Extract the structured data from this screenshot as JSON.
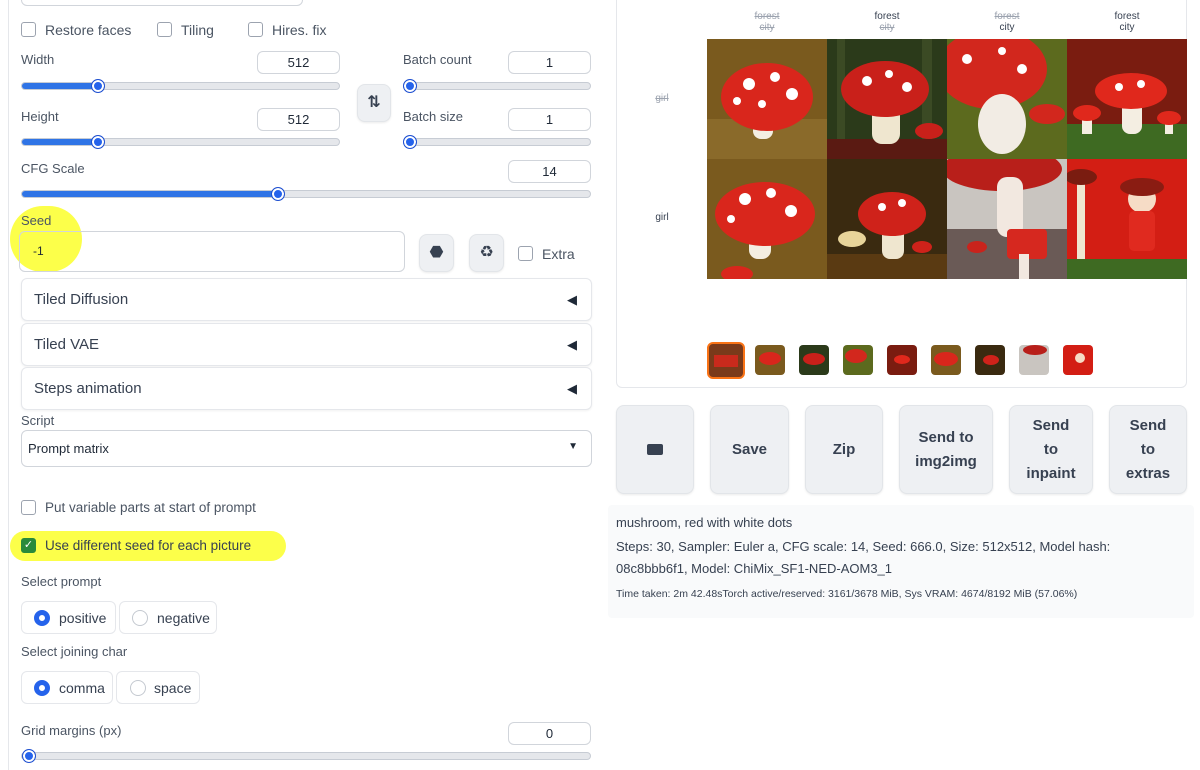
{
  "options": {
    "restore_faces": "Restore faces",
    "tiling": "Tiling",
    "hires_fix": "Hires. fix"
  },
  "width": {
    "label": "Width",
    "value": "512"
  },
  "height": {
    "label": "Height",
    "value": "512"
  },
  "batch_count": {
    "label": "Batch count",
    "value": "1"
  },
  "batch_size": {
    "label": "Batch size",
    "value": "1"
  },
  "cfg_scale": {
    "label": "CFG Scale",
    "value": "14"
  },
  "seed": {
    "label": "Seed",
    "value": "-1",
    "extra_label": "Extra"
  },
  "accordions": [
    "Tiled Diffusion",
    "Tiled VAE",
    "Steps animation"
  ],
  "script": {
    "label": "Script",
    "selected": "Prompt matrix"
  },
  "matrix": {
    "variable_parts": "Put variable parts at start of prompt",
    "different_seed": "Use different seed for each picture",
    "select_prompt_label": "Select prompt",
    "prompt_options": [
      "positive",
      "negative"
    ],
    "joining_label": "Select joining char",
    "joining_options": [
      "comma",
      "space"
    ],
    "grid_margins_label": "Grid margins (px)",
    "grid_margins_value": "0"
  },
  "grid": {
    "col_headers": [
      {
        "top": "forest",
        "top_on": false,
        "bottom": "city",
        "bottom_on": false
      },
      {
        "top": "forest",
        "top_on": true,
        "bottom": "city",
        "bottom_on": false
      },
      {
        "top": "forest",
        "top_on": false,
        "bottom": "city",
        "bottom_on": true
      },
      {
        "top": "forest",
        "top_on": true,
        "bottom": "city",
        "bottom_on": true
      }
    ],
    "row_headers": [
      {
        "text": "girl",
        "on": false
      },
      {
        "text": "girl",
        "on": true
      }
    ]
  },
  "actions": {
    "folder_icon": "folder-icon",
    "save": "Save",
    "zip": "Zip",
    "send_img2img": "Send to img2img",
    "send_inpaint": "Send to inpaint",
    "send_extras": "Send to extras"
  },
  "info": {
    "prompt": "mushroom, red with white dots",
    "params": "Steps: 30, Sampler: Euler a, CFG scale: 14, Seed: 666.0, Size: 512x512, Model hash: 08c8bbb6f1, Model: ChiMix_SF1-NED-AOM3_1",
    "time": "Time taken: 2m 42.48sTorch active/reserved: 3161/3678 MiB, Sys VRAM: 4674/8192 MiB (57.06%)"
  },
  "colors": {
    "accent": "#2563eb",
    "highlight": "#fbff2a",
    "selected_thumb": "#f97316"
  }
}
